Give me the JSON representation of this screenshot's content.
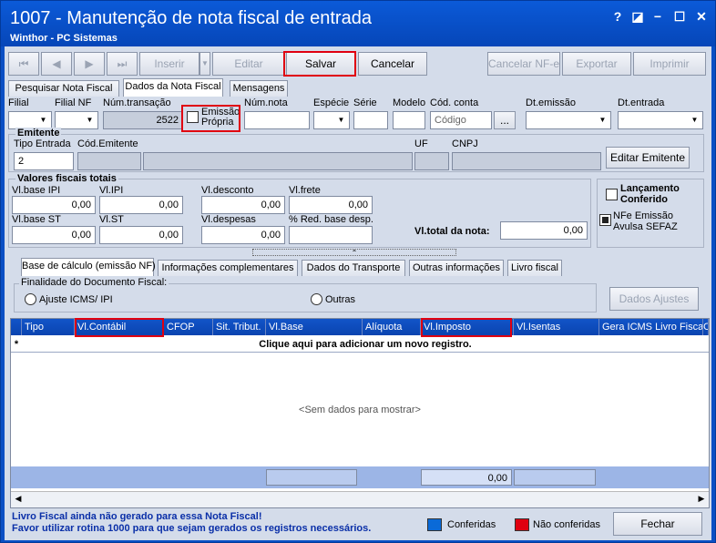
{
  "window": {
    "title": "1007 - Manutenção de nota fiscal de entrada",
    "subtitle": "Winthor - PC Sistemas",
    "help": "?",
    "restore": "◪",
    "minimize": "−",
    "maximize": "☐",
    "close": "✕"
  },
  "toolbar": {
    "first": "⏮",
    "prev": "◀",
    "next": "▶",
    "last": "⏭",
    "inserir": "Inserir",
    "editar": "Editar",
    "salvar": "Salvar",
    "cancelar": "Cancelar",
    "cancelar_nfe": "Cancelar NF-e",
    "exportar": "Exportar",
    "imprimir": "Imprimir"
  },
  "tabs": {
    "pesquisar": "Pesquisar Nota Fiscal",
    "dados": "Dados da Nota Fiscal",
    "mensagens": "Mensagens"
  },
  "header": {
    "filial": "Filial",
    "filial_nf": "Filial NF",
    "num_transacao": "Núm.transação",
    "num_transacao_value": "2522",
    "emissao_propria": "Emissão Própria",
    "num_nota": "Núm.nota",
    "especie": "Espécie",
    "serie": "Série",
    "modelo": "Modelo",
    "cod_conta": "Cód. conta",
    "cod_conta_placeholder": "Código",
    "cod_conta_btn": "...",
    "dt_emissao": "Dt.emissão",
    "dt_entrada": "Dt.entrada"
  },
  "emitente": {
    "title": "Emitente",
    "tipo_entrada": "Tipo Entrada",
    "tipo_entrada_value": "2",
    "cod_emitente": "Cód.Emitente",
    "uf": "UF",
    "cnpj": "CNPJ",
    "editar_btn": "Editar Emitente"
  },
  "valores": {
    "title": "Valores fiscais totais",
    "vl_base_ipi": "Vl.base IPI",
    "vl_base_ipi_value": "0,00",
    "vl_ipi": "Vl.IPI",
    "vl_ipi_value": "0,00",
    "vl_desconto": "Vl.desconto",
    "vl_desconto_value": "0,00",
    "vl_frete": "Vl.frete",
    "vl_frete_value": "0,00",
    "vl_base_st": "Vl.base ST",
    "vl_base_st_value": "0,00",
    "vl_st": "Vl.ST",
    "vl_st_value": "0,00",
    "vl_despesas": "Vl.despesas",
    "vl_despesas_value": "0,00",
    "red_base": "% Red. base desp.",
    "vl_total": "Vl.total da nota:",
    "vl_total_value": "0,00"
  },
  "side": {
    "lancamento": "Lançamento Conferido",
    "nfe_emissao": "NFe Emissão Avulsa SEFAZ"
  },
  "subtabs": {
    "base_calculo": "Base de cálculo (emissão NF)",
    "info_compl": "Informações complementares",
    "transporte": "Dados do Transporte",
    "outras": "Outras informações",
    "livro": "Livro fiscal"
  },
  "finalidade": {
    "title": "Finalidade do Documento Fiscal:",
    "ajuste": "Ajuste ICMS/ IPI",
    "outras": "Outras",
    "dados_ajustes": "Dados Ajustes"
  },
  "grid": {
    "columns": [
      "Tipo",
      "Vl.Contábil",
      "CFOP",
      "Sit. Tribut.",
      "Vl.Base",
      "Alíquota",
      "Vl.Imposto",
      "Vl.Isentas",
      "Gera ICMS Livro Fiscal",
      "C"
    ],
    "new_row": "Clique aqui para adicionar um novo registro.",
    "empty": "<Sem dados para mostrar>",
    "footer_total": "0,00"
  },
  "status": {
    "line1": "Livro Fiscal ainda não gerado para essa Nota Fiscal!",
    "line2": "Favor utilizar rotina 1000 para que sejam gerados os registros necessários.",
    "conferidas": "Conferidas",
    "nao_conferidas": "Não conferidas",
    "fechar": "Fechar",
    "color_conferidas": "#0a6ad8",
    "color_nao": "#e00010"
  }
}
